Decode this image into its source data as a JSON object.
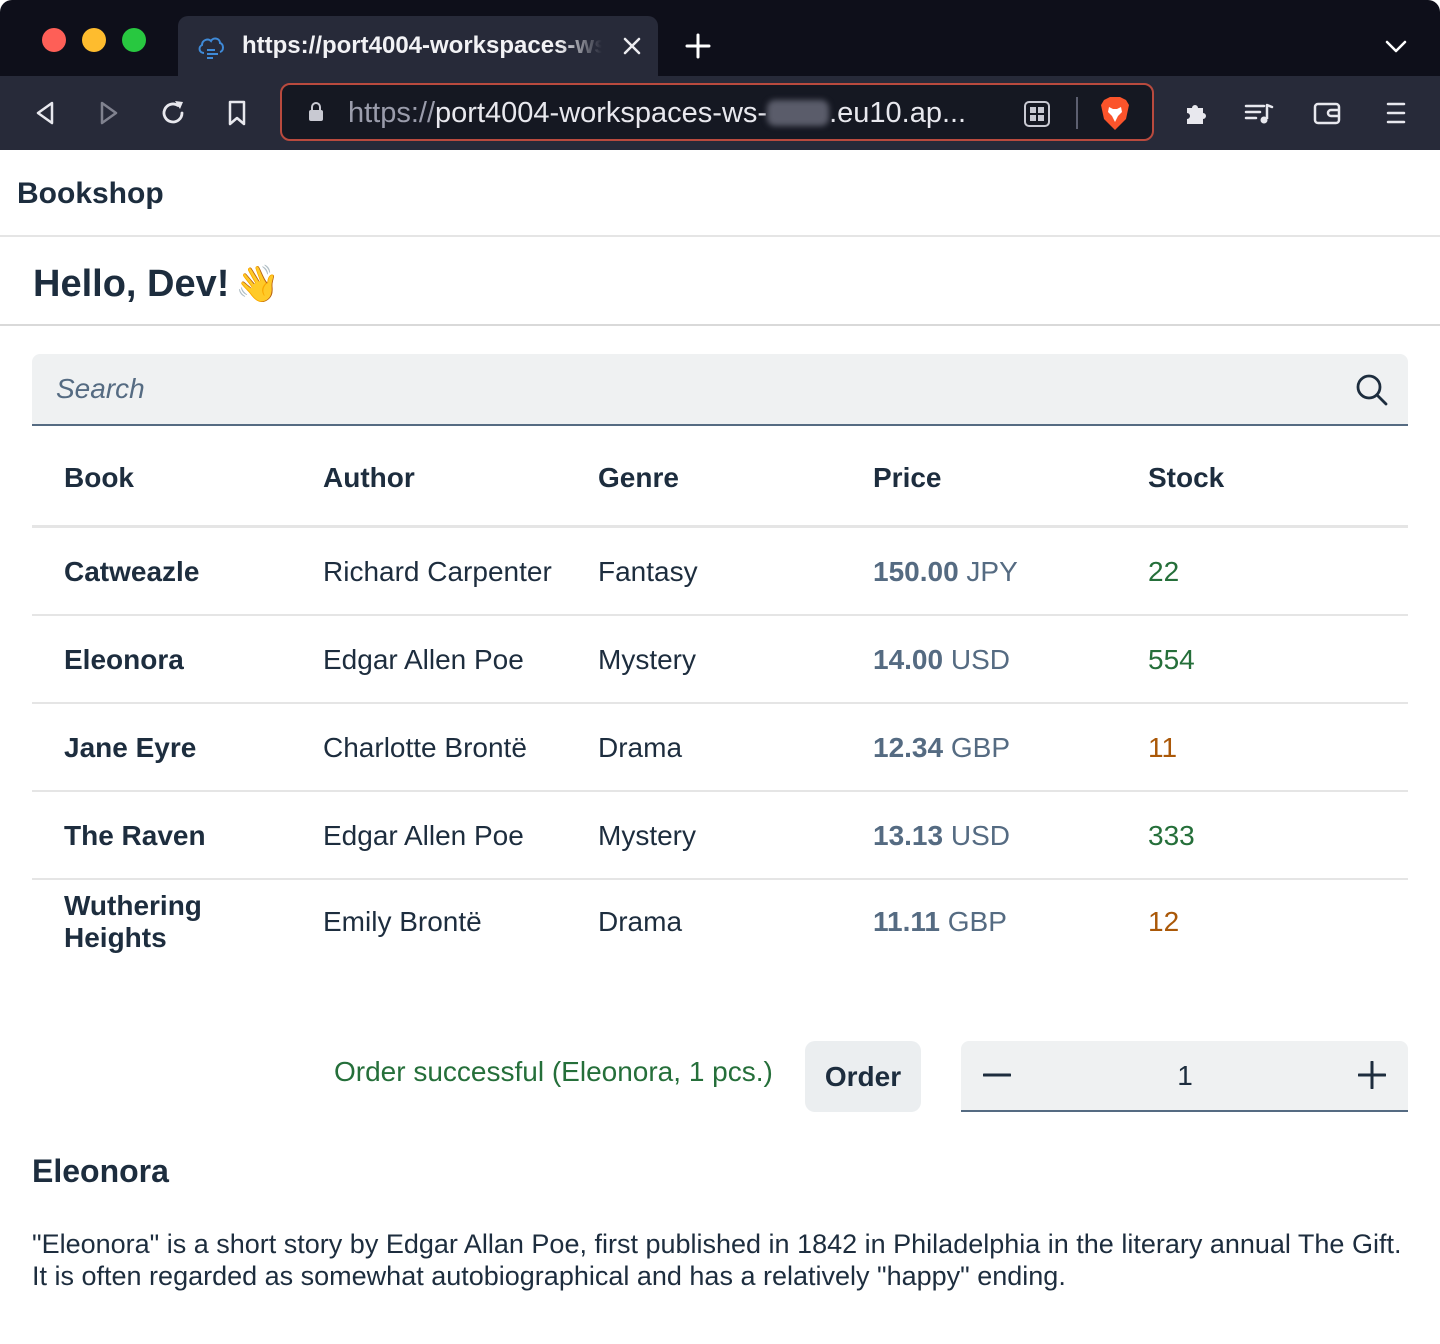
{
  "browser": {
    "tab_title": "https://port4004-workspaces-ws-",
    "url_scheme": "https://",
    "url_host_start": "port4004-workspaces-ws-",
    "url_host_end": ".eu10.ap..."
  },
  "shellbar": {
    "title": "Bookshop"
  },
  "page": {
    "greeting": "Hello, Dev!",
    "greeting_emoji": "👋"
  },
  "search": {
    "placeholder": "Search"
  },
  "table": {
    "columns": [
      "Book",
      "Author",
      "Genre",
      "Price",
      "Stock"
    ],
    "rows": [
      {
        "title": "Catweazle",
        "author": "Richard Carpenter",
        "genre": "Fantasy",
        "price": "150.00",
        "currency": "JPY",
        "stock": "22",
        "stock_status": "good"
      },
      {
        "title": "Eleonora",
        "author": "Edgar Allen Poe",
        "genre": "Mystery",
        "price": "14.00",
        "currency": "USD",
        "stock": "554",
        "stock_status": "good"
      },
      {
        "title": "Jane Eyre",
        "author": "Charlotte Brontë",
        "genre": "Drama",
        "price": "12.34",
        "currency": "GBP",
        "stock": "11",
        "stock_status": "low"
      },
      {
        "title": "The Raven",
        "author": "Edgar Allen Poe",
        "genre": "Mystery",
        "price": "13.13",
        "currency": "USD",
        "stock": "333",
        "stock_status": "good"
      },
      {
        "title": "Wuthering Heights",
        "author": "Emily Brontë",
        "genre": "Drama",
        "price": "11.11",
        "currency": "GBP",
        "stock": "12",
        "stock_status": "low"
      }
    ]
  },
  "order": {
    "message": "Order successful (Eleonora, 1 pcs.)",
    "button_label": "Order",
    "quantity": "1"
  },
  "detail": {
    "title": "Eleonora",
    "description": "\"Eleonora\" is a short story by Edgar Allan Poe, first published in 1842 in Philadelphia in the literary annual The Gift. It is often regarded as somewhat autobiographical and has a relatively \"happy\" ending."
  },
  "colors": {
    "stock_good": "#256f3a",
    "stock_low": "#aa5808",
    "success_text": "#256f3a",
    "text_primary": "#1d2d3e",
    "text_secondary": "#556b82"
  },
  "icons": {
    "search": "search-icon",
    "decrement": "minus-icon",
    "increment": "plus-icon",
    "greeting": "waving-hand-emoji"
  }
}
